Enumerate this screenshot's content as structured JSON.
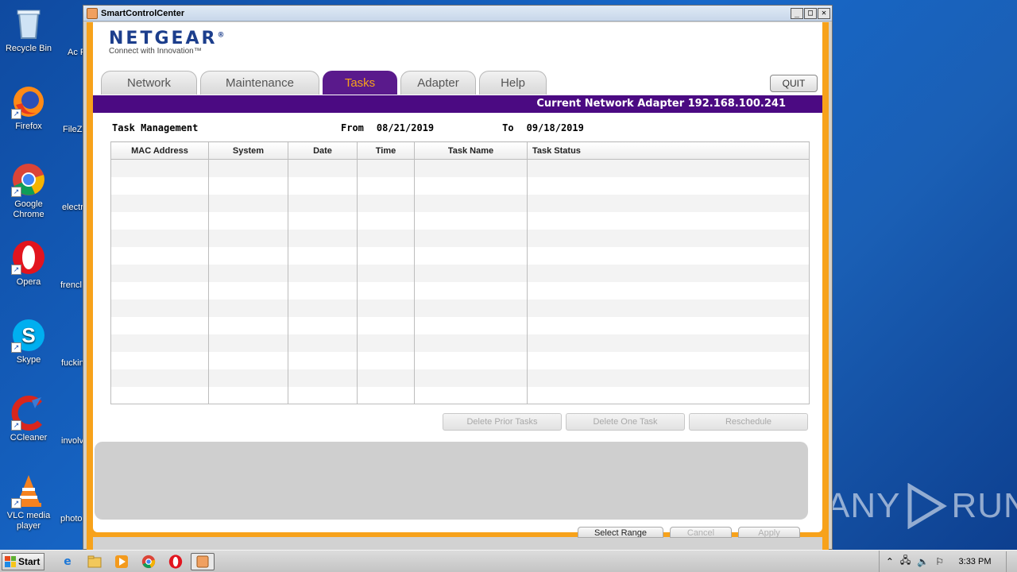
{
  "desktop": {
    "icons": [
      {
        "label": "Recycle Bin",
        "icon": "recycle-bin-icon"
      },
      {
        "label": "Firefox",
        "icon": "firefox-icon"
      },
      {
        "label": "Google Chrome",
        "icon": "chrome-icon"
      },
      {
        "label": "Opera",
        "icon": "opera-icon"
      },
      {
        "label": "Skype",
        "icon": "skype-icon"
      },
      {
        "label": "CCleaner",
        "icon": "ccleaner-icon"
      },
      {
        "label": "VLC media player",
        "icon": "vlc-icon"
      }
    ],
    "partial_icons": [
      "Ac Rea",
      "FileZi",
      "electr",
      "frencl",
      "fuckin",
      "involv",
      "photo"
    ],
    "watermark": {
      "left": "ANY",
      "right": "RUN"
    }
  },
  "window": {
    "title": "SmartControlCenter",
    "controls": {
      "minimize": "_",
      "maximize": "□",
      "close": "✕"
    }
  },
  "app": {
    "brand": "NETGEAR",
    "brand_mark": "®",
    "tagline": "Connect with Innovation™",
    "tabs": [
      {
        "label": "Network",
        "active": false
      },
      {
        "label": "Maintenance",
        "active": false
      },
      {
        "label": "Tasks",
        "active": true
      },
      {
        "label": "Adapter",
        "active": false
      },
      {
        "label": "Help",
        "active": false
      }
    ],
    "quit_label": "QUIT",
    "adapter_label": "Current Network Adapter 192.168.100.241",
    "colors": {
      "accent_orange": "#f7a21b",
      "brand_purple": "#4b0a82",
      "brand_blue": "#1c3e8c"
    }
  },
  "tasks": {
    "heading": "Task Management",
    "from_label": "From",
    "from_date": "08/21/2019",
    "to_label": "To",
    "to_date": "09/18/2019",
    "columns": [
      "MAC Address",
      "System",
      "Date",
      "Time",
      "Task Name",
      "Task Status"
    ],
    "rows": [],
    "actions": [
      {
        "label": "Delete Prior Tasks",
        "enabled": false
      },
      {
        "label": "Delete One Task",
        "enabled": false
      },
      {
        "label": "Reschedule",
        "enabled": false
      }
    ]
  },
  "footer": {
    "buttons": [
      {
        "label": "Select Range",
        "enabled": true
      },
      {
        "label": "Cancel",
        "enabled": false
      },
      {
        "label": "Apply",
        "enabled": false
      }
    ]
  },
  "taskbar": {
    "start_label": "Start",
    "pinned": [
      "ie-icon",
      "explorer-icon",
      "media-player-icon",
      "chrome-icon",
      "opera-icon",
      "smartcontrolcenter-icon"
    ],
    "clock": "3:33 PM"
  }
}
